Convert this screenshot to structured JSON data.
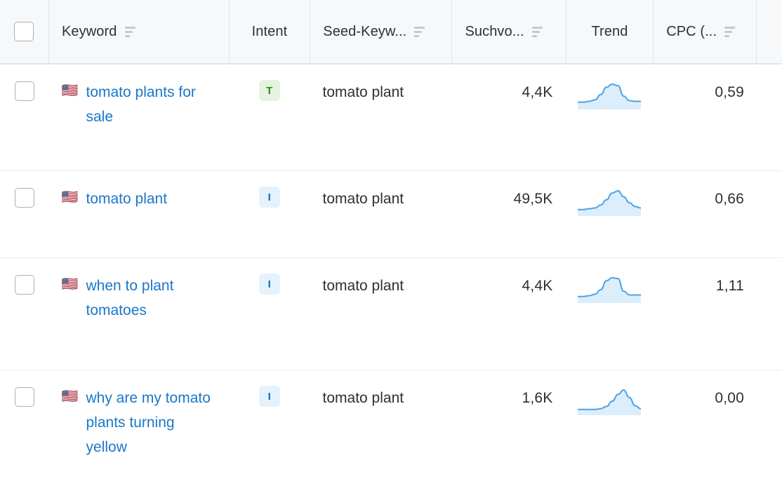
{
  "table": {
    "columns": [
      {
        "key": "checkbox",
        "label": "",
        "sortable": false,
        "icon": "checkbox-icon"
      },
      {
        "key": "keyword",
        "label": "Keyword",
        "sortable": true
      },
      {
        "key": "intent",
        "label": "Intent",
        "sortable": false
      },
      {
        "key": "seed",
        "label": "Seed-Keyw...",
        "sortable": true
      },
      {
        "key": "volume",
        "label": "Suchvo...",
        "sortable": true
      },
      {
        "key": "trend",
        "label": "Trend",
        "sortable": false
      },
      {
        "key": "cpc",
        "label": "CPC (...",
        "sortable": true
      }
    ],
    "select_all_checkbox": "unchecked",
    "sort_icon_name": "sort-icon",
    "rows": [
      {
        "checked": false,
        "flag": "🇺🇸",
        "flag_name": "us-flag-icon",
        "keyword": "tomato plants for sale",
        "intent": "T",
        "intent_name": "transactional",
        "seed_keyword": "tomato plant",
        "search_volume": "4,4K",
        "cpc": "0,59",
        "trend_points": [
          6,
          6,
          7,
          9,
          16,
          26,
          30,
          28,
          14,
          8,
          7,
          7
        ]
      },
      {
        "checked": false,
        "flag": "🇺🇸",
        "flag_name": "us-flag-icon",
        "keyword": "tomato plant",
        "intent": "I",
        "intent_name": "informational",
        "seed_keyword": "tomato plant",
        "search_volume": "49,5K",
        "cpc": "0,66",
        "trend_points": [
          5,
          5,
          6,
          7,
          11,
          18,
          27,
          30,
          22,
          14,
          9,
          7
        ]
      },
      {
        "checked": false,
        "flag": "🇺🇸",
        "flag_name": "us-flag-icon",
        "keyword": "when to plant tomatoes",
        "intent": "I",
        "intent_name": "informational",
        "seed_keyword": "tomato plant",
        "search_volume": "4,4K",
        "cpc": "1,11",
        "trend_points": [
          5,
          5,
          6,
          8,
          14,
          26,
          30,
          29,
          12,
          7,
          7,
          7
        ]
      },
      {
        "checked": false,
        "flag": "🇺🇸",
        "flag_name": "us-flag-icon",
        "keyword": "why are my tomato plants turning yellow",
        "intent": "I",
        "intent_name": "informational",
        "seed_keyword": "tomato plant",
        "search_volume": "1,6K",
        "cpc": "0,00",
        "trend_points": [
          4,
          4,
          4,
          4,
          5,
          8,
          15,
          24,
          30,
          20,
          9,
          5
        ]
      }
    ]
  },
  "colors": {
    "link": "#1a77c9",
    "header_bg": "#f7f8f9",
    "border": "#e1e4e8",
    "spark_line": "#4aa3e8",
    "spark_fill": "#dcedfb",
    "intent_informational_bg": "#e3f2fd",
    "intent_informational_fg": "#0a72b9",
    "intent_transactional_bg": "#e5f3e1",
    "intent_transactional_fg": "#2f8a22",
    "text": "#2b3137"
  },
  "chart_data": {
    "type": "line",
    "title": "Trend sparklines (12-month search volume trend per keyword)",
    "xlabel": "",
    "ylabel": "",
    "grid": false,
    "legend": "none",
    "x": [
      1,
      2,
      3,
      4,
      5,
      6,
      7,
      8,
      9,
      10,
      11,
      12
    ],
    "ylim": [
      0,
      32
    ],
    "series": [
      {
        "name": "tomato plants for sale",
        "values": [
          6,
          6,
          7,
          9,
          16,
          26,
          30,
          28,
          14,
          8,
          7,
          7
        ]
      },
      {
        "name": "tomato plant",
        "values": [
          5,
          5,
          6,
          7,
          11,
          18,
          27,
          30,
          22,
          14,
          9,
          7
        ]
      },
      {
        "name": "when to plant tomatoes",
        "values": [
          5,
          5,
          6,
          8,
          14,
          26,
          30,
          29,
          12,
          7,
          7,
          7
        ]
      },
      {
        "name": "why are my tomato plants turning yellow",
        "values": [
          4,
          4,
          4,
          4,
          5,
          8,
          15,
          24,
          30,
          20,
          9,
          5
        ]
      }
    ]
  }
}
